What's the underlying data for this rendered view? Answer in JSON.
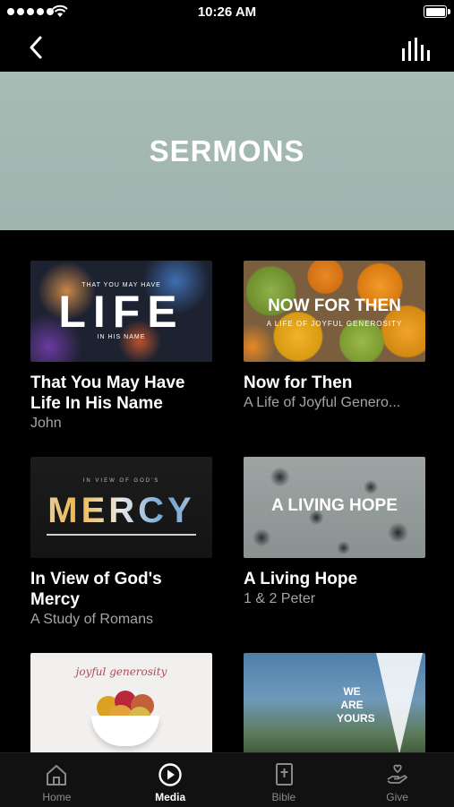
{
  "status_bar": {
    "time": "10:26 AM"
  },
  "banner": {
    "title": "SERMONS"
  },
  "sermons": [
    {
      "title": "That You May Have Life In His Name",
      "subtitle": "John",
      "thumb": {
        "big": "LIFE",
        "top": "THAT YOU MAY HAVE",
        "bottom": "IN HIS NAME"
      }
    },
    {
      "title": "Now for Then",
      "subtitle": "A Life of Joyful Genero...",
      "thumb": {
        "big": "NOW FOR THEN",
        "small": "A LIFE OF JOYFUL GENEROSITY"
      }
    },
    {
      "title": "In View of God's Mercy",
      "subtitle": "A Study of Romans",
      "thumb": {
        "big": "MERCY",
        "small": "IN VIEW OF GOD'S"
      }
    },
    {
      "title": "A Living Hope",
      "subtitle": "1 & 2 Peter",
      "thumb": {
        "big": "A LIVING HOPE"
      }
    },
    {
      "title": "",
      "subtitle": "",
      "thumb": {
        "script": "joyful generosity"
      }
    },
    {
      "title": "",
      "subtitle": "",
      "thumb": {
        "line1": "WE",
        "line2": "ARE",
        "line3": "YOURS"
      }
    }
  ],
  "tabs": [
    {
      "label": "Home",
      "icon": "home-icon",
      "active": false
    },
    {
      "label": "Media",
      "icon": "play-circle-icon",
      "active": true
    },
    {
      "label": "Bible",
      "icon": "bible-icon",
      "active": false
    },
    {
      "label": "Give",
      "icon": "give-hand-icon",
      "active": false
    }
  ],
  "colors": {
    "banner_bg": "#a8bcb6",
    "background": "#000000",
    "subtitle": "#a5a5a5",
    "tab_inactive": "#8a8a8a"
  }
}
